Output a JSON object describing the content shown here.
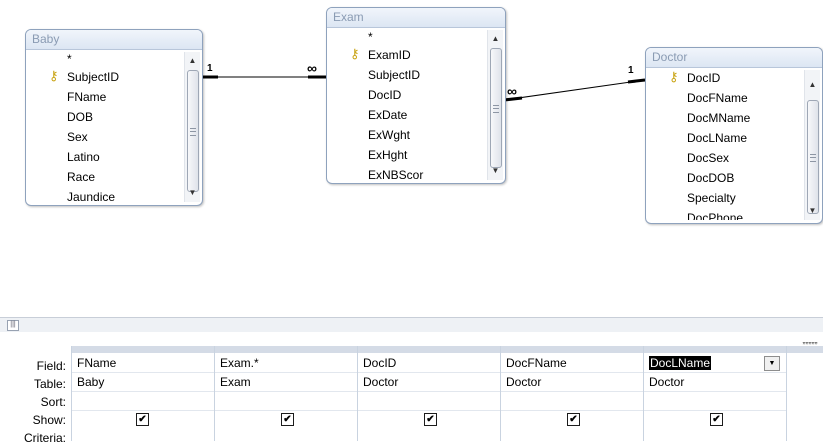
{
  "tables": {
    "baby": {
      "title": "Baby",
      "fields": [
        "*",
        "SubjectID",
        "FName",
        "DOB",
        "Sex",
        "Latino",
        "Race",
        "Jaundice"
      ]
    },
    "exam": {
      "title": "Exam",
      "fields": [
        "*",
        "ExamID",
        "SubjectID",
        "DocID",
        "ExDate",
        "ExWght",
        "ExHght",
        "ExNBScor"
      ]
    },
    "doctor": {
      "title": "Doctor",
      "fields": [
        "DocID",
        "DocFName",
        "DocMName",
        "DocLName",
        "DocSex",
        "DocDOB",
        "Specialty",
        "DocPhone"
      ]
    }
  },
  "relationships": [
    {
      "from": "Baby",
      "to": "Exam",
      "one_label": "1",
      "many_label": "∞"
    },
    {
      "from": "Exam",
      "to": "Doctor",
      "many_label": "∞",
      "one_label": "1"
    }
  ],
  "grid": {
    "row_labels": {
      "field": "Field:",
      "table": "Table:",
      "sort": "Sort:",
      "show": "Show:",
      "criteria": "Criteria:"
    },
    "columns": [
      {
        "field": "FName",
        "table": "Baby",
        "show": true
      },
      {
        "field": "Exam.*",
        "table": "Exam",
        "show": true
      },
      {
        "field": "DocID",
        "table": "Doctor",
        "show": true
      },
      {
        "field": "DocFName",
        "table": "Doctor",
        "show": true
      },
      {
        "field": "DocLName",
        "table": "Doctor",
        "show": true
      }
    ]
  },
  "icons": {
    "key": "key-icon",
    "checkmark": "✔",
    "scroll_up": "▲",
    "scroll_down": "▼",
    "dropdown": "▼"
  }
}
